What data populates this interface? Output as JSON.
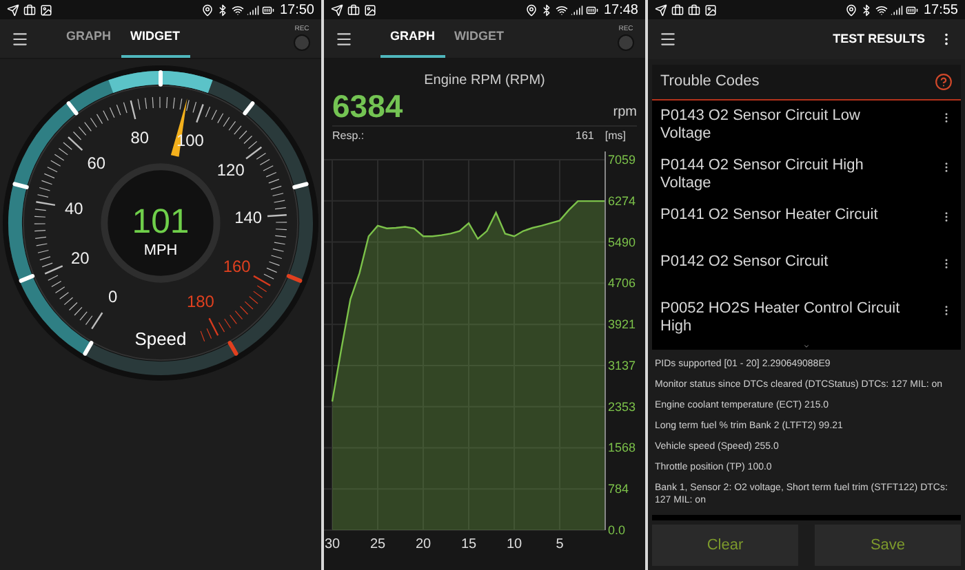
{
  "screens": [
    {
      "kind": "widget",
      "status_time": "17:50",
      "tabs": [
        {
          "label": "GRAPH",
          "selected": false
        },
        {
          "label": "WIDGET",
          "selected": true
        }
      ],
      "rec_label": "REC",
      "gauge": {
        "scale": [
          {
            "label": "0",
            "danger": false
          },
          {
            "label": "20",
            "danger": false
          },
          {
            "label": "40",
            "danger": false
          },
          {
            "label": "60",
            "danger": false
          },
          {
            "label": "80",
            "danger": false
          },
          {
            "label": "100",
            "danger": false
          },
          {
            "label": "120",
            "danger": false
          },
          {
            "label": "140",
            "danger": false
          },
          {
            "label": "160",
            "danger": true
          },
          {
            "label": "180",
            "danger": true
          }
        ],
        "value": "101",
        "unit": "MPH",
        "label": "Speed"
      }
    },
    {
      "kind": "graph",
      "status_time": "17:48",
      "tabs": [
        {
          "label": "GRAPH",
          "selected": true
        },
        {
          "label": "WIDGET",
          "selected": false
        }
      ],
      "rec_label": "REC",
      "title": "Engine RPM (RPM)",
      "value": "6384",
      "unit": "rpm",
      "resp_label": "Resp.:",
      "resp_value": "161",
      "resp_unit": "[ms]",
      "chart_data": {
        "type": "area",
        "x": [
          30,
          29,
          28,
          27,
          26,
          25,
          24,
          23,
          22,
          21,
          20,
          19,
          18,
          17,
          16,
          15,
          14,
          13,
          12,
          11,
          10,
          9,
          8,
          7,
          6,
          5,
          4,
          3,
          2,
          1,
          0
        ],
        "series": [
          {
            "color": "#7cc24a",
            "values": [
              2450,
              3450,
              4400,
              4900,
              5600,
              5800,
              5750,
              5760,
              5780,
              5750,
              5600,
              5600,
              5620,
              5650,
              5700,
              5850,
              5550,
              5700,
              6050,
              5650,
              5600,
              5700,
              5760,
              5800,
              5850,
              5900,
              6100,
              6270,
              6270,
              6270,
              6270
            ]
          }
        ],
        "xlim": [
          30,
          0
        ],
        "ylim": [
          0,
          7059
        ],
        "grid": true,
        "xticks": [
          30,
          25,
          20,
          15,
          10,
          5
        ],
        "yticks": [
          {
            "value": 0,
            "label": "0.0"
          },
          784,
          1568,
          2353,
          3137,
          3921,
          4706,
          5490,
          6274,
          7059
        ]
      }
    },
    {
      "kind": "results",
      "status_time": "17:55",
      "toolbar_title": "TEST RESULTS",
      "card": {
        "title": "Trouble Codes",
        "codes": [
          "P0143 O2 Sensor Circuit Low Voltage",
          "P0144 O2 Sensor Circuit High Voltage",
          "P0141 O2 Sensor Heater Circuit",
          "P0142 O2 Sensor Circuit",
          "P0052 HO2S Heater Control Circuit High"
        ]
      },
      "details": [
        "PIDs supported [01 - 20] 2.290649088E9",
        "Monitor status since DTCs cleared (DTCStatus) DTCs: 127 MIL: on",
        "Engine coolant temperature (ECT) 215.0",
        "Long term fuel % trim Bank 2 (LTFT2) 99.21",
        "Vehicle speed (Speed) 255.0",
        "Throttle position (TP) 100.0",
        "Bank 1, Sensor 2: O2 voltage, Short term fuel trim (STFT122) DTCs: 127 MIL: on"
      ],
      "buttons": [
        "Clear",
        "Save"
      ]
    }
  ]
}
